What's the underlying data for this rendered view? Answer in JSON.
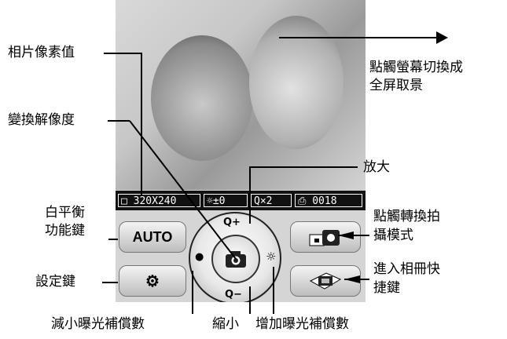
{
  "status_bar": {
    "resolution": "□ 320X240",
    "exposure": "☼±0",
    "zoom": "Q×2",
    "shots": "⎙ 0018"
  },
  "buttons": {
    "white_balance": "AUTO",
    "settings_icon": "gear-icon",
    "shooting_mode_icon": "camera-mode-icon",
    "album_icon": "album-icon",
    "capture_icon": "camera-icon"
  },
  "wheel": {
    "zoom_in": "Q+",
    "zoom_out": "Q−",
    "exposure_down": "●",
    "exposure_up": "☼"
  },
  "callouts": {
    "photo_pixels": "相片像素值",
    "change_resolution": "變換解像度",
    "white_balance_line1": "白平衡",
    "white_balance_line2": "功能鍵",
    "settings_key": "設定鍵",
    "touch_fullscreen_line1": "點觸螢幕切換成",
    "touch_fullscreen_line2": "全屏取景",
    "zoom_in": "放大",
    "switch_mode_line1": "點觸轉換拍",
    "switch_mode_line2": "攝模式",
    "album_line1": "進入相冊快",
    "album_line2": "捷鍵",
    "exposure_down": "減小曝光補償數",
    "zoom_out": "縮小",
    "exposure_up": "增加曝光補償數"
  }
}
